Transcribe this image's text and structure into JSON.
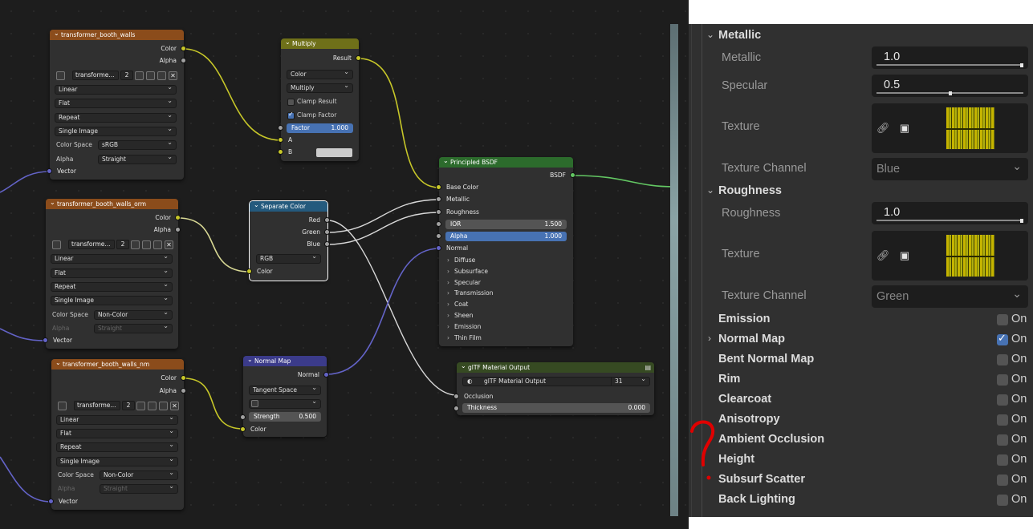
{
  "nodes": {
    "tex1": {
      "title": "transformer_booth_walls",
      "outputs": [
        "Color",
        "Alpha"
      ],
      "image_name": "transforme...",
      "users": "2",
      "interpolation": "Linear",
      "projection": "Flat",
      "extension": "Repeat",
      "source": "Single Image",
      "color_space_label": "Color Space",
      "color_space": "sRGB",
      "alpha_label": "Alpha",
      "alpha": "Straight",
      "vector": "Vector"
    },
    "tex2": {
      "title": "transformer_booth_walls_orm",
      "outputs": [
        "Color",
        "Alpha"
      ],
      "image_name": "transforme...",
      "users": "2",
      "interpolation": "Linear",
      "projection": "Flat",
      "extension": "Repeat",
      "source": "Single Image",
      "color_space_label": "Color Space",
      "color_space": "Non-Color",
      "alpha_label": "Alpha",
      "alpha": "Straight",
      "vector": "Vector"
    },
    "tex3": {
      "title": "transformer_booth_walls_nm",
      "outputs": [
        "Color",
        "Alpha"
      ],
      "image_name": "transforme...",
      "users": "2",
      "interpolation": "Linear",
      "projection": "Flat",
      "extension": "Repeat",
      "source": "Single Image",
      "color_space_label": "Color Space",
      "color_space": "Non-Color",
      "alpha_label": "Alpha",
      "alpha": "Straight",
      "vector": "Vector"
    },
    "multiply": {
      "title": "Multiply",
      "output": "Result",
      "data_type": "Color",
      "blend": "Multiply",
      "clamp_result": "Clamp Result",
      "clamp_factor": "Clamp Factor",
      "factor_label": "Factor",
      "factor_value": "1.000",
      "a": "A",
      "b": "B"
    },
    "separate": {
      "title": "Separate Color",
      "outputs": [
        "Red",
        "Green",
        "Blue"
      ],
      "mode": "RGB",
      "input": "Color"
    },
    "bsdf": {
      "title": "Principled BSDF",
      "output": "BSDF",
      "inputs": [
        "Base Color",
        "Metallic",
        "Roughness"
      ],
      "ior_label": "IOR",
      "ior_value": "1.500",
      "alpha_label": "Alpha",
      "alpha_value": "1.000",
      "normal": "Normal",
      "panels": [
        "Diffuse",
        "Subsurface",
        "Specular",
        "Transmission",
        "Coat",
        "Sheen",
        "Emission",
        "Thin Film"
      ]
    },
    "normalmap": {
      "title": "Normal Map",
      "output": "Normal",
      "space": "Tangent Space",
      "strength_label": "Strength",
      "strength_value": "0.500",
      "input": "Color"
    },
    "gltf": {
      "title": "glTF Material Output",
      "group_name": "glTF Material Output",
      "users": "31",
      "occlusion": "Occlusion",
      "thickness_label": "Thickness",
      "thickness_value": "0.000"
    }
  },
  "props": {
    "metallic_section": "Metallic",
    "metallic_label": "Metallic",
    "metallic_value": "1.0",
    "metallic_fill": 1.0,
    "specular_label": "Specular",
    "specular_value": "0.5",
    "specular_fill": 0.5,
    "texture_label": "Texture",
    "texture_channel_label": "Texture Channel",
    "metallic_channel": "Blue",
    "roughness_section": "Roughness",
    "roughness_label": "Roughness",
    "roughness_value": "1.0",
    "roughness_fill": 1.0,
    "roughness_texture_label": "Texture",
    "roughness_channel_label": "Texture Channel",
    "roughness_channel": "Green",
    "extensions": [
      {
        "name": "Emission",
        "on": false,
        "expandable": false
      },
      {
        "name": "Normal Map",
        "on": true,
        "expandable": true
      },
      {
        "name": "Bent Normal Map",
        "on": false,
        "expandable": false
      },
      {
        "name": "Rim",
        "on": false,
        "expandable": false
      },
      {
        "name": "Clearcoat",
        "on": false,
        "expandable": false
      },
      {
        "name": "Anisotropy",
        "on": false,
        "expandable": false
      },
      {
        "name": "Ambient Occlusion",
        "on": false,
        "expandable": false
      },
      {
        "name": "Height",
        "on": false,
        "expandable": false
      },
      {
        "name": "Subsurf Scatter",
        "on": false,
        "expandable": false
      },
      {
        "name": "Back Lighting",
        "on": false,
        "expandable": false
      }
    ],
    "toggle_label": "On"
  },
  "colors": {
    "wire_yellow": "#c7c729",
    "wire_gray": "#d8d8d8",
    "wire_blue": "#6363c7",
    "wire_green": "#63c763",
    "annotation_red": "#e00000"
  }
}
